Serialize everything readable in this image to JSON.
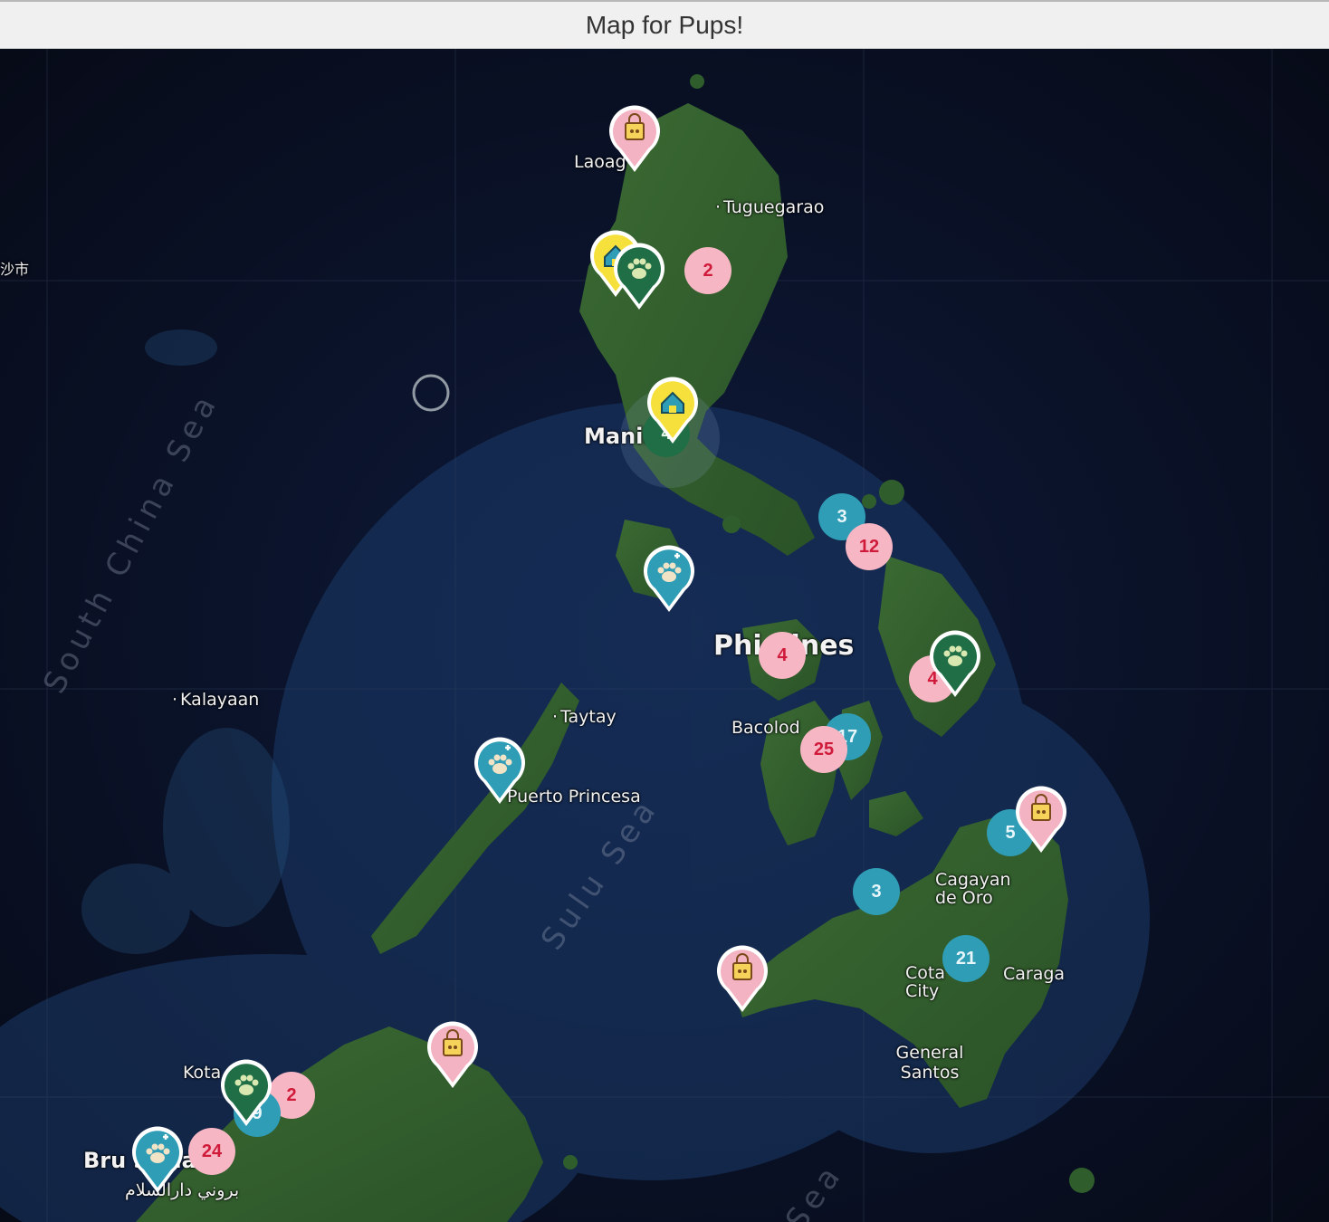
{
  "window": {
    "title": "Map for Pups!"
  },
  "map": {
    "labels": [
      {
        "id": "laoag",
        "text": "Laoag"
      },
      {
        "id": "tuguegarao",
        "text": "Tuguegarao"
      },
      {
        "id": "manila",
        "text": "Manil"
      },
      {
        "id": "philippines",
        "text": "Phi     pines"
      },
      {
        "id": "kalayaan",
        "text": "Kalayaan"
      },
      {
        "id": "taytay",
        "text": "Taytay"
      },
      {
        "id": "bacolod",
        "text": "Bacolod"
      },
      {
        "id": "puerto-princesa",
        "text": "Puerto Princesa"
      },
      {
        "id": "cagayan",
        "text": "Cagayan de Oro"
      },
      {
        "id": "caraga",
        "text": "Caraga"
      },
      {
        "id": "cotabato",
        "text": "Cota     City"
      },
      {
        "id": "general-santos",
        "text": "General Santos"
      },
      {
        "id": "kota",
        "text": "Kota"
      },
      {
        "id": "brunei",
        "text": "Bru         ssalam"
      },
      {
        "id": "brunei-ar",
        "text": "بروني دارالسلام"
      },
      {
        "id": "cn-city",
        "text": "沙市"
      }
    ],
    "seas": [
      {
        "id": "south-china-sea",
        "text": "South China Sea"
      },
      {
        "id": "sulu-sea",
        "text": "Sulu Sea"
      },
      {
        "id": "celebes-sea",
        "text": "Sea"
      }
    ],
    "clusters": [
      {
        "id": "c1",
        "count": "2",
        "color": "pink"
      },
      {
        "id": "c2",
        "count": "4",
        "color": "green"
      },
      {
        "id": "c3",
        "count": "3",
        "color": "teal"
      },
      {
        "id": "c4",
        "count": "12",
        "color": "pink"
      },
      {
        "id": "c5",
        "count": "4",
        "color": "pink"
      },
      {
        "id": "c6",
        "count": "4",
        "color": "pink"
      },
      {
        "id": "c7",
        "count": "17",
        "color": "teal"
      },
      {
        "id": "c8",
        "count": "25",
        "color": "pink"
      },
      {
        "id": "c9",
        "count": "5",
        "color": "teal"
      },
      {
        "id": "c10",
        "count": "3",
        "color": "teal"
      },
      {
        "id": "c11",
        "count": "21",
        "color": "teal"
      },
      {
        "id": "c12",
        "count": "2",
        "color": "pink"
      },
      {
        "id": "c13",
        "count": "24",
        "color": "pink"
      },
      {
        "id": "c14",
        "count": "9",
        "color": "teal"
      }
    ],
    "pins": [
      {
        "id": "p1",
        "type": "pet-store",
        "color": "#f4b3c2",
        "icon": "shopping-bag-icon"
      },
      {
        "id": "p2",
        "type": "pet-hotel",
        "color": "#f6e13c",
        "icon": "house-icon"
      },
      {
        "id": "p3",
        "type": "dog-park",
        "color": "#1f6e45",
        "icon": "paw-icon"
      },
      {
        "id": "p4",
        "type": "pet-hotel",
        "color": "#f6e13c",
        "icon": "house-icon"
      },
      {
        "id": "p5",
        "type": "vet-clinic",
        "color": "#2f9db5",
        "icon": "paw-plus-icon"
      },
      {
        "id": "p6",
        "type": "dog-park",
        "color": "#1f6e45",
        "icon": "paw-icon"
      },
      {
        "id": "p7",
        "type": "vet-clinic",
        "color": "#2f9db5",
        "icon": "paw-plus-icon"
      },
      {
        "id": "p8",
        "type": "pet-store",
        "color": "#f4b3c2",
        "icon": "shopping-bag-icon"
      },
      {
        "id": "p9",
        "type": "pet-store",
        "color": "#f4b3c2",
        "icon": "shopping-bag-icon"
      },
      {
        "id": "p10",
        "type": "pet-store",
        "color": "#f4b3c2",
        "icon": "shopping-bag-icon"
      },
      {
        "id": "p11",
        "type": "dog-park",
        "color": "#1f6e45",
        "icon": "paw-icon"
      },
      {
        "id": "p12",
        "type": "vet-clinic",
        "color": "#2f9db5",
        "icon": "paw-plus-icon"
      }
    ]
  }
}
